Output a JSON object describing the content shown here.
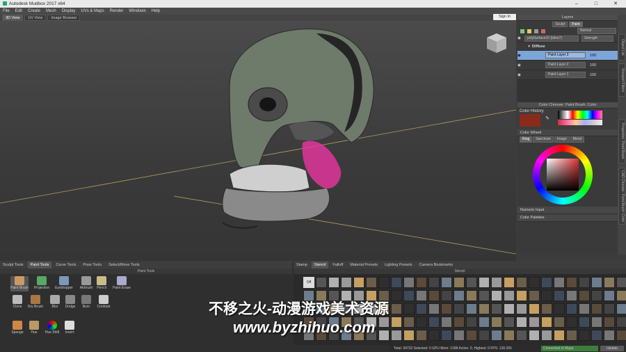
{
  "app": {
    "title": "Autodesk Mudbox 2017 x64"
  },
  "menu": [
    "File",
    "Edit",
    "Create",
    "Mesh",
    "Display",
    "UVs & Maps",
    "Render",
    "Windows",
    "Help"
  ],
  "view_tabs": [
    "3D View",
    "UV View",
    "Image Browser"
  ],
  "signin": "Sign In",
  "layers": {
    "title": "Layers",
    "tabs": [
      "Sculpt",
      "Paint"
    ],
    "blend_mode": "Normal",
    "object": "polySurface15 (blinn7)",
    "strength_label": "Strength",
    "channel": "Diffuse",
    "items": [
      {
        "name": "Paint Layer 3",
        "value": "100"
      },
      {
        "name": "Paint Layer 2",
        "value": "100"
      },
      {
        "name": "Paint Layer 1",
        "value": "100"
      }
    ]
  },
  "color_chooser": {
    "title": "Color Chooser: Paint Brush: Color",
    "history_label": "Color History",
    "wheel_label": "Color Wheel",
    "wheel_tabs": [
      "Ring",
      "Spectrum",
      "Image",
      "Blend"
    ],
    "numeric": "Numeric Input",
    "palettes": "Color Palettes"
  },
  "side_tabs": [
    "Object List",
    "Viewport Filters",
    "Properties: Paint Brush",
    "CAD Chooser: Paint Brush: Color"
  ],
  "tool_tabs": [
    "Sculpt Tools",
    "Paint Tools",
    "Curve Tools",
    "Pose Tools",
    "Select/Move Tools"
  ],
  "tool_header": "Paint Tools",
  "tools": [
    [
      "Paint Brush",
      "Projection",
      "Eyedropper",
      "Airbrush",
      "Pencil",
      "Paint Erase"
    ],
    [
      "Clone",
      "Dry Brush",
      "Blur",
      "Dodge",
      "Burn",
      "Contrast"
    ],
    [
      "Sponge",
      "Hue",
      "Hue Shift",
      "Invert"
    ]
  ],
  "stamp_tabs": [
    "Stamp",
    "Stencil",
    "Falloff",
    "Material Presets",
    "Lighting Presets",
    "Camera Bookmarks"
  ],
  "stamp_header": "Stencil",
  "stamp_off": "Off",
  "status": {
    "text": "Total: 34732  Selected: 0  GPU Mem: 1398  Active: 0, Highest: 0  FPS: 128.265",
    "maya": "Connected to Maya",
    "update": "Update"
  },
  "watermark": {
    "title": "不移之火-动漫游戏美术资源",
    "url": "www.byzhihuo.com"
  },
  "colors": {
    "accent": "#7da6d8",
    "magenta": "#e0359b",
    "history_swatch": "#8a2a1a"
  }
}
